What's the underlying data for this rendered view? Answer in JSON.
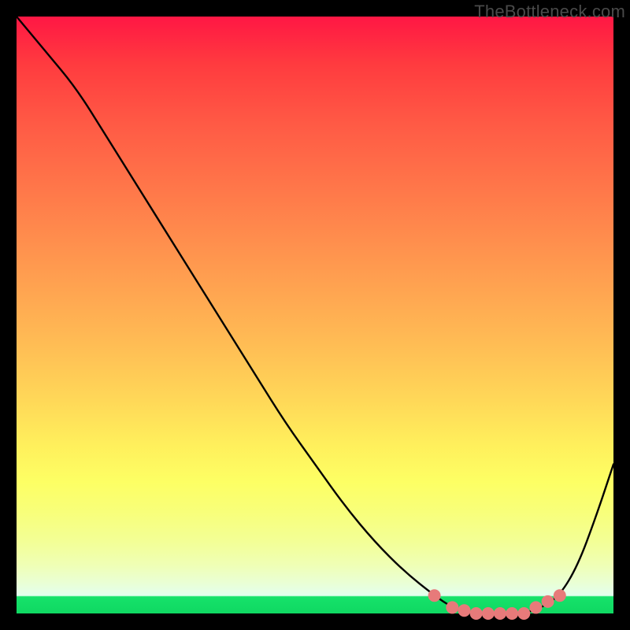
{
  "branding": {
    "watermark": "TheBottleneck.com"
  },
  "colors": {
    "curve_stroke": "#000000",
    "marker_fill": "#e77a7a",
    "marker_stroke": "#b84a4a",
    "frame_bg": "#000000"
  },
  "chart_data": {
    "type": "line",
    "title": "",
    "xlabel": "",
    "ylabel": "",
    "xlim": [
      0,
      100
    ],
    "ylim": [
      0,
      100
    ],
    "grid": false,
    "legend": false,
    "series": [
      {
        "name": "bottleneck-curve",
        "x": [
          0,
          5,
          10,
          15,
          20,
          25,
          30,
          35,
          40,
          45,
          50,
          55,
          60,
          65,
          70,
          73,
          76,
          79,
          82,
          85,
          88,
          91,
          94,
          97,
          100
        ],
        "values": [
          100,
          94,
          88,
          80,
          72,
          64,
          56,
          48,
          40,
          32,
          25,
          18,
          12,
          7,
          3,
          1,
          0,
          0,
          0,
          0,
          1,
          3,
          8,
          16,
          25
        ]
      }
    ],
    "markers": {
      "name": "valley-markers",
      "x": [
        70,
        73,
        75,
        77,
        79,
        81,
        83,
        85,
        87,
        89,
        91
      ],
      "values": [
        3,
        1,
        0.5,
        0,
        0,
        0,
        0,
        0,
        1,
        2,
        3
      ]
    }
  }
}
